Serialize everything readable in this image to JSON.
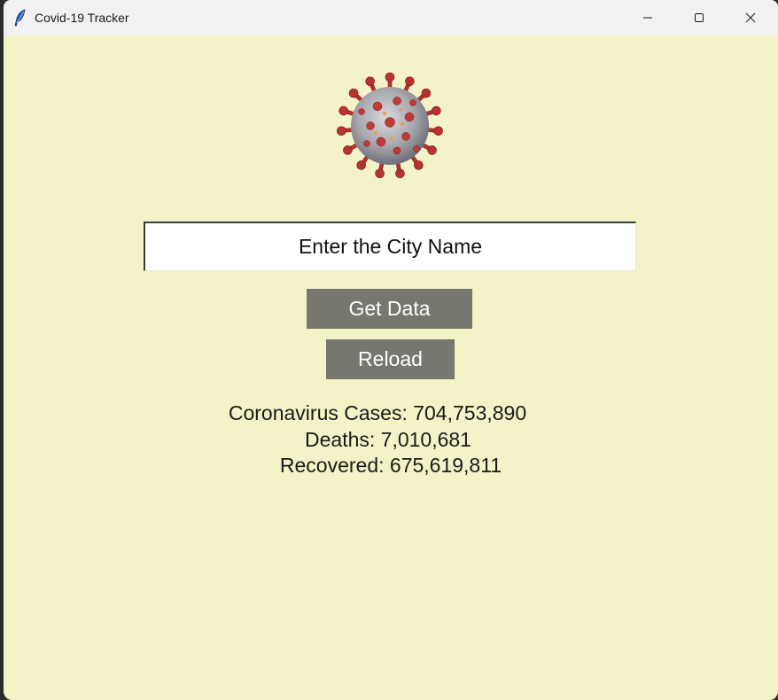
{
  "window": {
    "title": "Covid-19 Tracker",
    "icons": {
      "app": "feather-icon",
      "minimize": "minimize-icon",
      "maximize": "maximize-icon",
      "close": "close-icon"
    }
  },
  "colors": {
    "background": "#f3f3c7",
    "button": "#77776f",
    "button_text": "#ffffff",
    "titlebar": "#f3f0f3"
  },
  "logo": {
    "icon": "coronavirus-icon"
  },
  "search": {
    "placeholder": "Enter the City Name",
    "value": ""
  },
  "buttons": {
    "get_data": "Get Data",
    "reload": "Reload"
  },
  "stats": {
    "cases": "Coronavirus Cases: 704,753,890",
    "deaths": "Deaths: 7,010,681",
    "recovered": "Recovered: 675,619,811"
  }
}
